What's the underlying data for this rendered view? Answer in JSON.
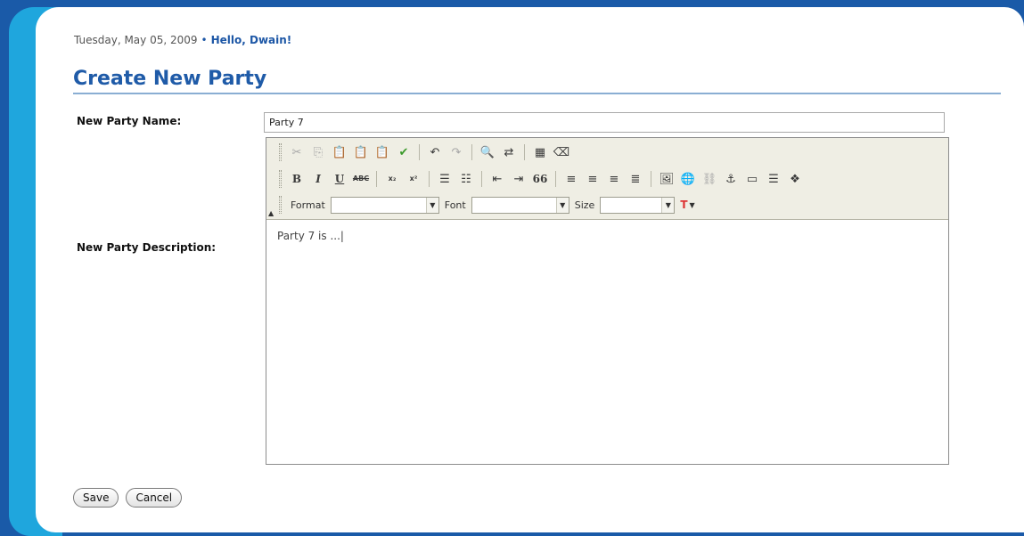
{
  "header": {
    "date": "Tuesday, May 05, 2009",
    "separator": "•",
    "greeting": "Hello, Dwain!"
  },
  "page": {
    "title": "Create New Party"
  },
  "form": {
    "name_label": "New Party Name:",
    "name_value": "Party 7",
    "description_label": "New Party Description:",
    "description_value": "Party 7 is ...|"
  },
  "editor": {
    "toolbar": {
      "format_label": "Format",
      "font_label": "Font",
      "size_label": "Size",
      "bold": "B",
      "italic": "I",
      "underline": "U",
      "strike": "ABC",
      "subscript": "x₂",
      "superscript": "x²",
      "blockquote": "66",
      "text_color": "T",
      "icons": [
        "cut-icon",
        "copy-icon",
        "paste-icon",
        "paste-text-icon",
        "paste-word-icon",
        "spellcheck-icon",
        "undo-icon",
        "redo-icon",
        "find-icon",
        "replace-icon",
        "select-all-icon",
        "remove-format-icon",
        "ordered-list-icon",
        "unordered-list-icon",
        "outdent-icon",
        "indent-icon",
        "align-left-icon",
        "align-center-icon",
        "align-right-icon",
        "justify-icon",
        "image-icon",
        "link-icon",
        "unlink-icon",
        "anchor-icon",
        "table-icon",
        "horizontal-rule-icon",
        "special-char-icon"
      ]
    }
  },
  "actions": {
    "save_label": "Save",
    "cancel_label": "Cancel"
  },
  "colors": {
    "frame": "#1a5aa8",
    "accent": "#1fa6dd",
    "title": "#1f5ba8",
    "toolbar_bg": "#efeee4"
  }
}
